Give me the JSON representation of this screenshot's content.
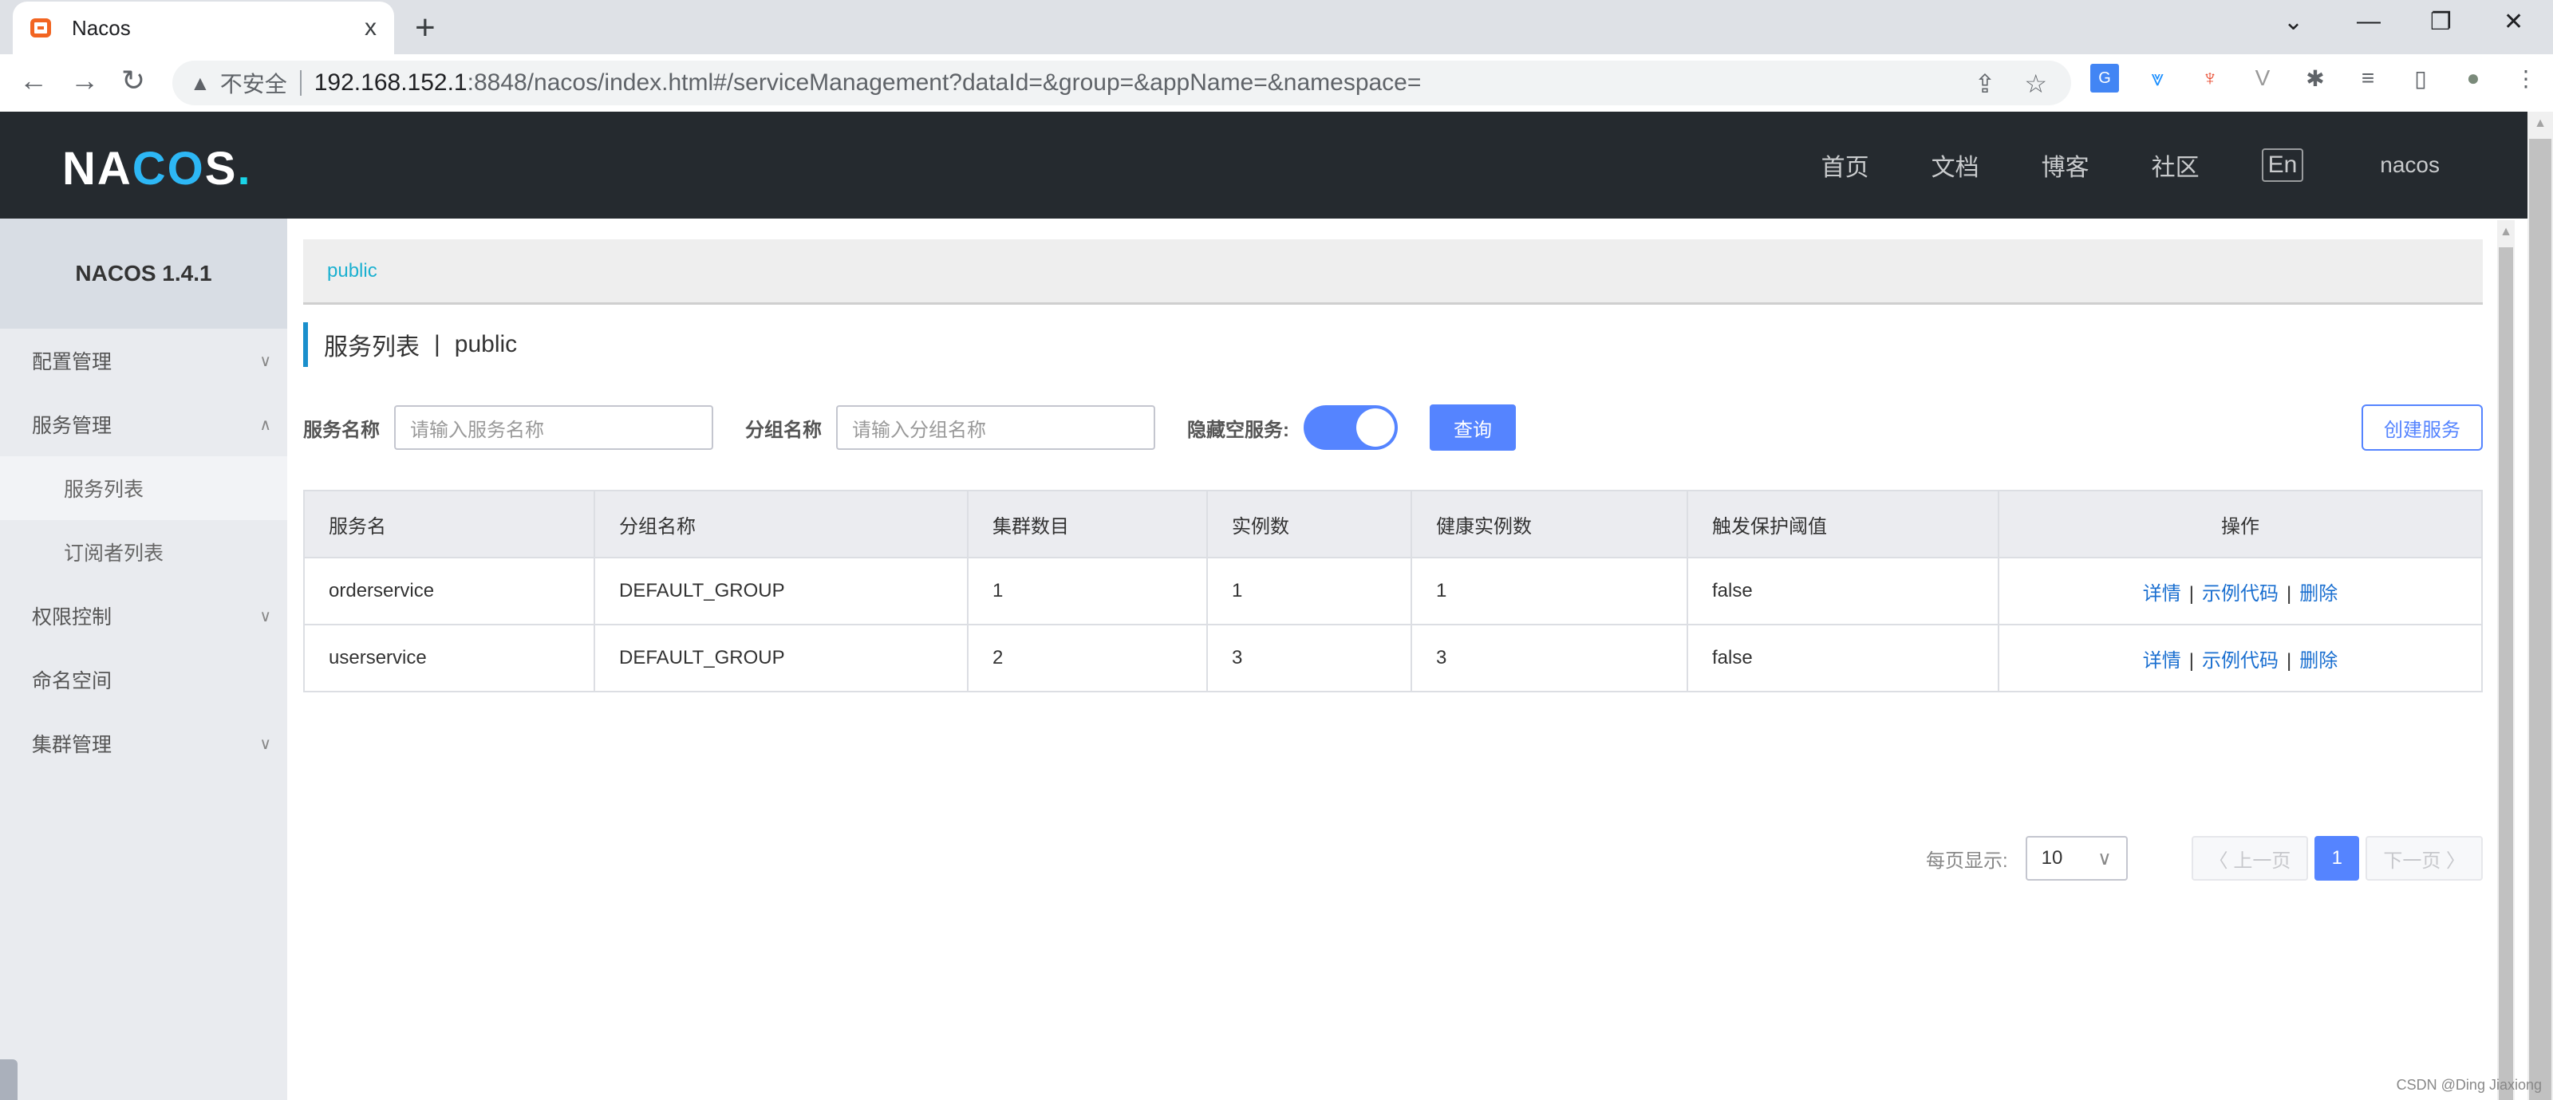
{
  "browser": {
    "tab_title": "Nacos",
    "tab_close": "x",
    "new_tab": "+",
    "window_controls": {
      "tabsearch": "⌄",
      "minimize": "—",
      "restore": "❐",
      "close": "✕"
    },
    "nav": {
      "back": "←",
      "forward": "→",
      "reload": "↻"
    },
    "security_icon": "▲",
    "security_label": "不安全",
    "url_host": "192.168.152.1",
    "url_rest": ":8848/nacos/index.html#/serviceManagement?dataId=&group=&appName=&namespace=",
    "actions": {
      "share": "⇪",
      "bookmark": "☆"
    },
    "extensions": [
      "G",
      "⩔",
      "♆",
      "V",
      "✱",
      "≡",
      "▯",
      "●",
      "⋮"
    ]
  },
  "header": {
    "logo_pre": "NA",
    "logo_mid": "CO",
    "logo_post": "S",
    "logo_dot": ".",
    "nav": [
      "首页",
      "文档",
      "博客",
      "社区"
    ],
    "lang": "En",
    "user": "nacos"
  },
  "sidebar": {
    "title": "NACOS 1.4.1",
    "items": [
      {
        "label": "配置管理",
        "chevron": "∨"
      },
      {
        "label": "服务管理",
        "chevron": "∧"
      },
      {
        "label": "服务列表"
      },
      {
        "label": "订阅者列表"
      },
      {
        "label": "权限控制",
        "chevron": "∨"
      },
      {
        "label": "命名空间"
      },
      {
        "label": "集群管理",
        "chevron": "∨"
      }
    ]
  },
  "main": {
    "namespace": "public",
    "title": "服务列表",
    "title_sep": "|",
    "title_ns": "public",
    "filters": {
      "service_label": "服务名称",
      "service_placeholder": "请输入服务名称",
      "group_label": "分组名称",
      "group_placeholder": "请输入分组名称",
      "hide_empty_label": "隐藏空服务:",
      "hide_empty_on": true,
      "query": "查询",
      "create": "创建服务"
    },
    "table": {
      "headers": [
        "服务名",
        "分组名称",
        "集群数目",
        "实例数",
        "健康实例数",
        "触发保护阈值",
        "操作"
      ],
      "rows": [
        {
          "name": "orderservice",
          "group": "DEFAULT_GROUP",
          "clusters": "1",
          "instances": "1",
          "healthy": "1",
          "threshold": "false"
        },
        {
          "name": "userservice",
          "group": "DEFAULT_GROUP",
          "clusters": "2",
          "instances": "3",
          "healthy": "3",
          "threshold": "false"
        }
      ],
      "ops": {
        "detail": "详情",
        "sample": "示例代码",
        "delete": "删除",
        "sep": "|"
      }
    },
    "pagination": {
      "per_page_label": "每页显示:",
      "per_page": "10",
      "prev": "〈 上一页",
      "current": "1",
      "next": "下一页 〉"
    }
  },
  "watermark": "CSDN @Ding Jiaxiong"
}
